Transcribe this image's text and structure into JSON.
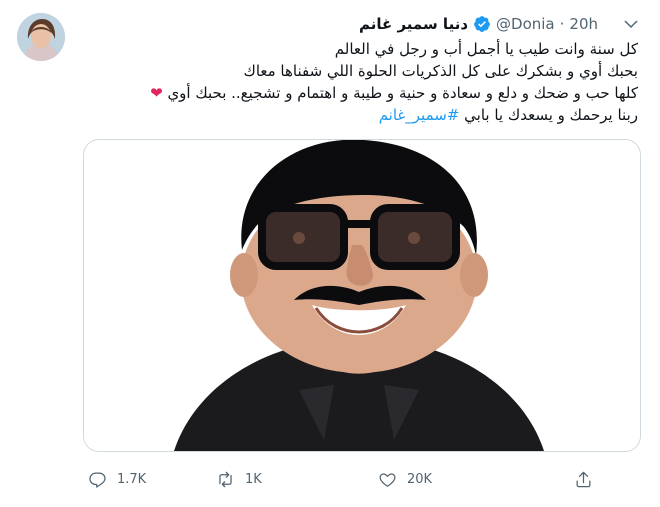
{
  "tweet": {
    "display_name": "دنيا سمير غانم",
    "handle": "@Donia",
    "separator": "·",
    "time": "20h",
    "text_lines": [
      "كل سنة وانت طيب يا أجمل أب و رجل في العالم",
      "بحبك أوي و بشكرك على كل الذكريات الحلوة اللي شفناها معاك",
      "كلها حب و ضحك و دلع و سعادة و حنية و طيبة و اهتمام و تشجيع.. بحبك أوي"
    ],
    "heart_emoji": "❤",
    "last_line_text": "ربنا يرحمك و يسعدك يا بابي ",
    "hashtag": "#سمير_غانم"
  },
  "actions": {
    "reply_count": "1.7K",
    "retweet_count": "1K",
    "like_count": "20K"
  },
  "colors": {
    "accent": "#1d9bf0",
    "text": "#0f1419",
    "muted": "#536471",
    "heart": "#e0245e"
  },
  "icons": [
    "verified-icon",
    "chevron-down-icon",
    "reply-icon",
    "retweet-icon",
    "like-icon",
    "share-icon"
  ]
}
